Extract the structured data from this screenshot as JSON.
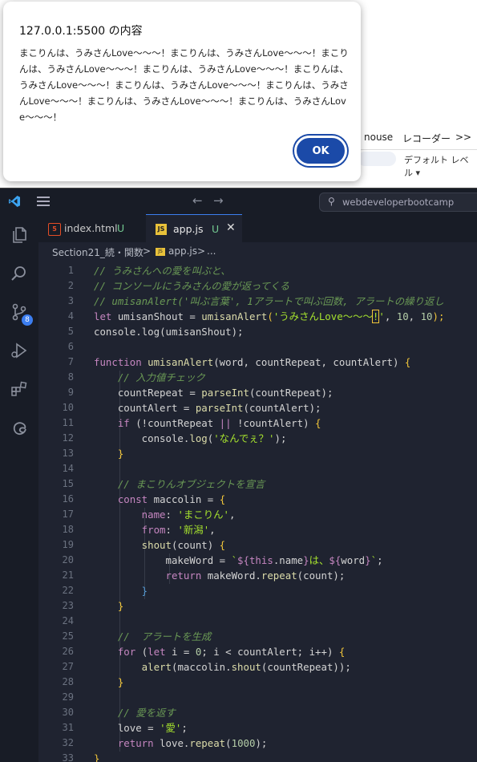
{
  "browser": {
    "devtools_tabs": [
      "nouse",
      "レコーダー",
      ">>"
    ],
    "default_level": "デフォルト レベル ▾"
  },
  "alert": {
    "title": "127.0.0.1:5500 の内容",
    "message": "まこりんは、うみさんLove〜〜〜！まこりんは、うみさんLove〜〜〜！まこりんは、うみさんLove〜〜〜！まこりんは、うみさんLove〜〜〜！まこりんは、うみさんLove〜〜〜！まこりんは、うみさんLove〜〜〜！まこりんは、うみさんLove〜〜〜！まこりんは、うみさんLove〜〜〜！まこりんは、うみさんLove〜〜〜！",
    "ok_label": "OK"
  },
  "vscode": {
    "search_text": "webdeveloperbootcamp",
    "badge_count": "8",
    "tabs": [
      {
        "name": "index.html",
        "modified": "U",
        "icon": "html-icon"
      },
      {
        "name": "app.js",
        "modified": "U",
        "icon": "js-icon",
        "close": "✕"
      }
    ],
    "breadcrumb": [
      "Section21_続・関数",
      ">",
      "app.js",
      ">",
      "..."
    ],
    "colors": {
      "keyword": "#c586c0",
      "blue_keyword": "#569cd6",
      "function": "#dcdcaa",
      "string": "#ce9178",
      "green_string": "#a6e22e",
      "number": "#b5cea8",
      "comment": "#6a9955",
      "variable": "#9cdcfe"
    }
  },
  "code_lines": [
    {
      "n": "1",
      "tokens": [
        {
          "t": "// うみさんへの愛を叫ぶと、",
          "c": "cm"
        }
      ]
    },
    {
      "n": "2",
      "tokens": [
        {
          "t": "// コンソールにうみさんの愛が返ってくる",
          "c": "cm"
        }
      ]
    },
    {
      "n": "3",
      "tokens": [
        {
          "t": "// umisanAlert('叫ぶ言葉', 1アラートで叫ぶ回数, アラートの繰り返し",
          "c": "cm"
        }
      ]
    },
    {
      "n": "4",
      "tokens": [
        {
          "t": "let ",
          "c": "kw"
        },
        {
          "t": "umisanShout",
          "c": "pl"
        },
        {
          "t": " = ",
          "c": "pl"
        },
        {
          "t": "umisanAlert",
          "c": "fn"
        },
        {
          "t": "(",
          "c": "br"
        },
        {
          "t": "'うみさんLove〜〜〜",
          "c": "gs"
        },
        {
          "t": "!",
          "c": "gs"
        },
        {
          "t": "'",
          "c": "gs"
        },
        {
          "t": ", ",
          "c": "pl"
        },
        {
          "t": "10",
          "c": "nm"
        },
        {
          "t": ", ",
          "c": "pl"
        },
        {
          "t": "10",
          "c": "nm"
        },
        {
          "t": ");",
          "c": "br"
        }
      ]
    },
    {
      "n": "5",
      "tokens": [
        {
          "t": "console",
          "c": "pl"
        },
        {
          "t": ".",
          "c": "pl"
        },
        {
          "t": "log",
          "c": "pl"
        },
        {
          "t": "(umisanShout);",
          "c": "pl"
        }
      ]
    },
    {
      "n": "6",
      "tokens": []
    },
    {
      "n": "7",
      "tokens": [
        {
          "t": "function ",
          "c": "kw"
        },
        {
          "t": "umisanAlert",
          "c": "fn"
        },
        {
          "t": "(word, countRepeat, countAlert) ",
          "c": "pl"
        },
        {
          "t": "{",
          "c": "br"
        }
      ]
    },
    {
      "n": "8",
      "tokens": [
        {
          "t": "    // 入力値チェック",
          "c": "cm"
        }
      ]
    },
    {
      "n": "9",
      "tokens": [
        {
          "t": "    countRepeat = ",
          "c": "pl"
        },
        {
          "t": "parseInt",
          "c": "fn"
        },
        {
          "t": "(countRepeat);",
          "c": "pl"
        }
      ]
    },
    {
      "n": "10",
      "tokens": [
        {
          "t": "    countAlert = ",
          "c": "pl"
        },
        {
          "t": "parseInt",
          "c": "fn"
        },
        {
          "t": "(countAlert);",
          "c": "pl"
        }
      ]
    },
    {
      "n": "11",
      "tokens": [
        {
          "t": "    if ",
          "c": "kw"
        },
        {
          "t": "(!countRepeat ",
          "c": "pl"
        },
        {
          "t": "||",
          "c": "kw"
        },
        {
          "t": " !countAlert) ",
          "c": "pl"
        },
        {
          "t": "{",
          "c": "br"
        }
      ]
    },
    {
      "n": "12",
      "tokens": [
        {
          "t": "        console.",
          "c": "pl"
        },
        {
          "t": "log",
          "c": "fn"
        },
        {
          "t": "(",
          "c": "pl"
        },
        {
          "t": "'なんでぇ？'",
          "c": "gs"
        },
        {
          "t": ");",
          "c": "pl"
        }
      ]
    },
    {
      "n": "13",
      "tokens": [
        {
          "t": "    }",
          "c": "br"
        }
      ]
    },
    {
      "n": "14",
      "tokens": []
    },
    {
      "n": "15",
      "tokens": [
        {
          "t": "    // まこりんオブジェクトを宣言",
          "c": "cm"
        }
      ]
    },
    {
      "n": "16",
      "tokens": [
        {
          "t": "    const ",
          "c": "kw"
        },
        {
          "t": "maccolin",
          "c": "pl"
        },
        {
          "t": " = ",
          "c": "pl"
        },
        {
          "t": "{",
          "c": "br"
        }
      ]
    },
    {
      "n": "17",
      "tokens": [
        {
          "t": "        name",
          "c": "pr"
        },
        {
          "t": ": ",
          "c": "pl"
        },
        {
          "t": "'まこりん'",
          "c": "gs"
        },
        {
          "t": ",",
          "c": "pl"
        }
      ]
    },
    {
      "n": "18",
      "tokens": [
        {
          "t": "        from",
          "c": "pr"
        },
        {
          "t": ": ",
          "c": "pl"
        },
        {
          "t": "'新潟'",
          "c": "gs"
        },
        {
          "t": ",",
          "c": "pl"
        }
      ]
    },
    {
      "n": "19",
      "tokens": [
        {
          "t": "        shout",
          "c": "fn"
        },
        {
          "t": "(count) ",
          "c": "pl"
        },
        {
          "t": "{",
          "c": "br"
        }
      ]
    },
    {
      "n": "20",
      "tokens": [
        {
          "t": "            makeWord = ",
          "c": "pl"
        },
        {
          "t": "`",
          "c": "gs"
        },
        {
          "t": "${",
          "c": "kw"
        },
        {
          "t": "this",
          "c": "kw"
        },
        {
          "t": ".name",
          "c": "pl"
        },
        {
          "t": "}",
          "c": "kw"
        },
        {
          "t": "は、",
          "c": "gs"
        },
        {
          "t": "${",
          "c": "kw"
        },
        {
          "t": "word",
          "c": "pl"
        },
        {
          "t": "}",
          "c": "kw"
        },
        {
          "t": "`",
          "c": "gs"
        },
        {
          "t": ";",
          "c": "pl"
        }
      ]
    },
    {
      "n": "21",
      "tokens": [
        {
          "t": "            return ",
          "c": "kw"
        },
        {
          "t": "makeWord.",
          "c": "pl"
        },
        {
          "t": "repeat",
          "c": "fn"
        },
        {
          "t": "(count);",
          "c": "pl"
        }
      ]
    },
    {
      "n": "22",
      "tokens": [
        {
          "t": "        }",
          "c": "bl"
        }
      ]
    },
    {
      "n": "23",
      "tokens": [
        {
          "t": "    }",
          "c": "br"
        }
      ]
    },
    {
      "n": "24",
      "tokens": []
    },
    {
      "n": "25",
      "tokens": [
        {
          "t": "    //  アラートを生成",
          "c": "cm"
        }
      ]
    },
    {
      "n": "26",
      "tokens": [
        {
          "t": "    for ",
          "c": "kw"
        },
        {
          "t": "(",
          "c": "pl"
        },
        {
          "t": "let ",
          "c": "kw"
        },
        {
          "t": "i = ",
          "c": "pl"
        },
        {
          "t": "0",
          "c": "nm"
        },
        {
          "t": "; i < countAlert; i++) ",
          "c": "pl"
        },
        {
          "t": "{",
          "c": "br"
        }
      ]
    },
    {
      "n": "27",
      "tokens": [
        {
          "t": "        alert",
          "c": "fn"
        },
        {
          "t": "(maccolin.",
          "c": "pl"
        },
        {
          "t": "shout",
          "c": "fn"
        },
        {
          "t": "(countRepeat));",
          "c": "pl"
        }
      ]
    },
    {
      "n": "28",
      "tokens": [
        {
          "t": "    }",
          "c": "br"
        }
      ]
    },
    {
      "n": "29",
      "tokens": []
    },
    {
      "n": "30",
      "tokens": [
        {
          "t": "    // 愛を返す",
          "c": "cm"
        }
      ]
    },
    {
      "n": "31",
      "tokens": [
        {
          "t": "    love = ",
          "c": "pl"
        },
        {
          "t": "'愛'",
          "c": "gs"
        },
        {
          "t": ";",
          "c": "pl"
        }
      ]
    },
    {
      "n": "32",
      "tokens": [
        {
          "t": "    return ",
          "c": "kw"
        },
        {
          "t": "love.",
          "c": "pl"
        },
        {
          "t": "repeat",
          "c": "fn"
        },
        {
          "t": "(",
          "c": "pl"
        },
        {
          "t": "1000",
          "c": "nm"
        },
        {
          "t": ");",
          "c": "pl"
        }
      ]
    },
    {
      "n": "33",
      "tokens": [
        {
          "t": "}",
          "c": "br"
        }
      ]
    }
  ]
}
